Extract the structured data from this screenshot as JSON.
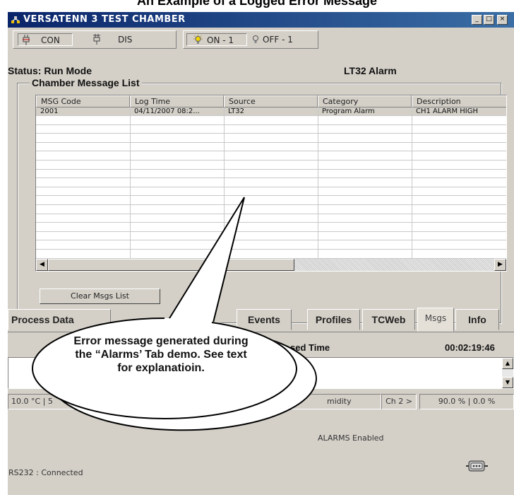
{
  "caption": "An Example of a Logged Error Message",
  "window": {
    "title": "VERSATENN 3 TEST CHAMBER",
    "controls": [
      "_",
      "□",
      "×"
    ]
  },
  "toolbar": {
    "con_label": "CON",
    "dis_label": "DIS",
    "on_label": "ON - 1",
    "off_label": "OFF - 1"
  },
  "status": {
    "label": "Status:  Run Mode",
    "alarm": "LT32 Alarm"
  },
  "message_list": {
    "title": "Chamber Message List",
    "columns": [
      "MSG Code",
      "Log Time",
      "Source",
      "Category",
      "Description"
    ],
    "rows": [
      [
        "2001",
        "04/11/2007 08:2...",
        "LT32",
        "Program Alarm",
        "CH1 ALARM HIGH"
      ]
    ],
    "clear_button": "Clear Msgs List"
  },
  "tabs": [
    "Process Data",
    "Events",
    "Profiles",
    "TCWeb",
    "Msgs",
    "Info"
  ],
  "active_tab": "Msgs",
  "elapsed": {
    "label": "sed Time",
    "value": "00:02:19:46"
  },
  "statusbar": {
    "ch1": "10.0 °C  |  5",
    "humidity": "midity",
    "ch2": "Ch 2 >",
    "ch2_values": "90.0 %  |  0.0 %"
  },
  "alarms_enabled": "ALARMS Enabled",
  "connection": "RS232 : Connected",
  "callout": {
    "line1": "Error message generated during",
    "line2": "the “Alarms’ Tab demo.  See text",
    "line3": "for explanatioin."
  }
}
